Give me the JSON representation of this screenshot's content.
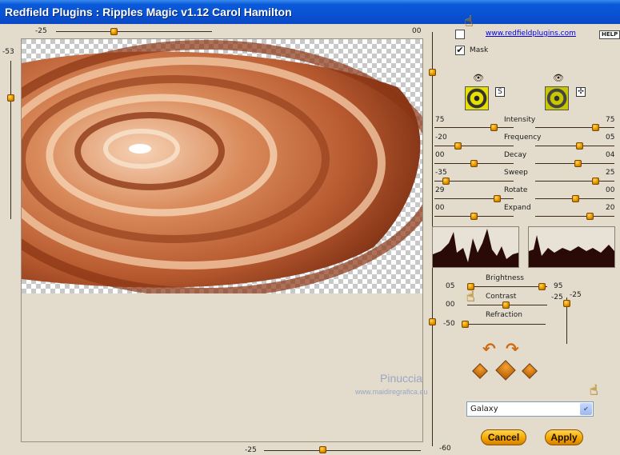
{
  "window": {
    "title": "Redfield Plugins : Ripples Magic v1.12   Carol Hamilton"
  },
  "top_slider": {
    "left_value": "-25",
    "right_value": "00"
  },
  "left_slider": {
    "value": "-53"
  },
  "bottom_slider": {
    "value": "-25"
  },
  "right_vertical_slider": {
    "value": "-60"
  },
  "header": {
    "link": "www.redfieldplugins.com",
    "help": "HELP",
    "mask_label": "Mask",
    "mask_checked": "✔"
  },
  "swatches": {
    "left_button": "S",
    "right_button": "✣"
  },
  "params": [
    {
      "label": "Intensity",
      "left": "75",
      "right": "75"
    },
    {
      "label": "Frequency",
      "left": "-20",
      "right": "05"
    },
    {
      "label": "Decay",
      "left": "00",
      "right": "04"
    },
    {
      "label": "Sweep",
      "left": "-35",
      "right": "25"
    },
    {
      "label": "Rotate",
      "left": "29",
      "right": "00"
    },
    {
      "label": "Expand",
      "left": "00",
      "right": "20"
    }
  ],
  "lower": {
    "brightness_label": "Brightness",
    "brightness_left": "05",
    "brightness_right": "95",
    "contrast_label": "Contrast",
    "contrast_left": "00",
    "contrast_right": "-25",
    "refraction_label": "Refraction",
    "refraction_left": "-50",
    "vertical_right": "-25"
  },
  "preset": {
    "selected": "Galaxy"
  },
  "buttons": {
    "cancel": "Cancel",
    "apply": "Apply"
  },
  "watermark": {
    "line1": "Pinuccia",
    "line2": "www.maidiregrafica.eu"
  },
  "colors": {
    "titlebar": "#0852d4",
    "accent": "#f0a000",
    "copper": "#c8643a"
  }
}
